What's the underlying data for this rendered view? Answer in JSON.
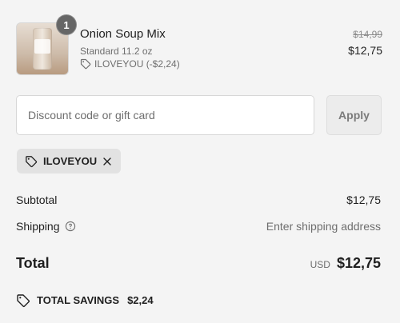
{
  "product": {
    "quantity": "1",
    "name": "Onion Soup Mix",
    "variant": "Standard 11.2 oz",
    "discount_line": "ILOVEYOU (-$2,24)",
    "original_price": "$14,99",
    "current_price": "$12,75",
    "thumbnail_icon": "product-jar"
  },
  "discount": {
    "placeholder": "Discount code or gift card",
    "value": "",
    "apply_label": "Apply",
    "applied_code": "ILOVEYOU"
  },
  "summary": {
    "subtotal_label": "Subtotal",
    "subtotal_value": "$12,75",
    "shipping_label": "Shipping",
    "shipping_value": "Enter shipping address",
    "total_label": "Total",
    "currency": "USD",
    "total_value": "$12,75"
  },
  "savings": {
    "label": "TOTAL SAVINGS",
    "value": "$2,24"
  },
  "colors": {
    "page_bg": "#f4f4f4",
    "text_primary": "#1f1f1f",
    "text_muted": "#6e6e6e",
    "chip_bg": "#e2e2e2",
    "badge_bg": "#666666",
    "button_bg": "#ececec"
  },
  "icons": {
    "discount_tag": "tag-icon",
    "remove_code": "close-icon",
    "shipping_help": "help-circle-icon",
    "total_savings": "tag-icon"
  }
}
